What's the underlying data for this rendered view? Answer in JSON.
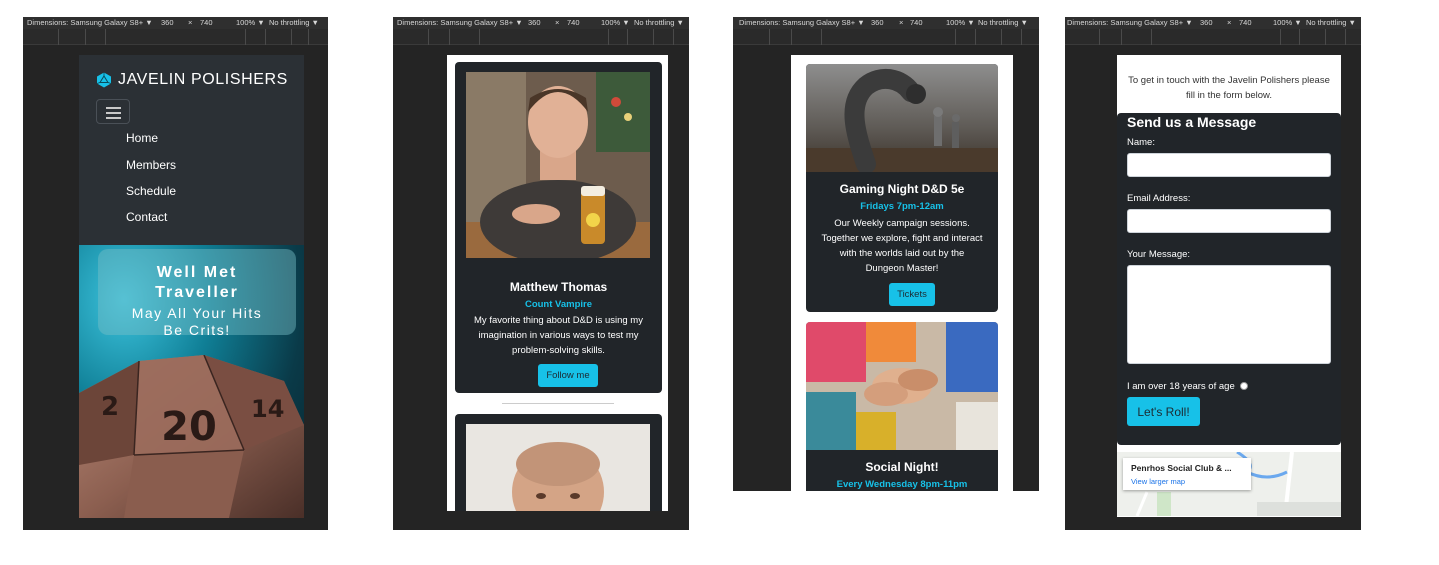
{
  "devtools": {
    "dimensions_label": "Dimensions: Samsung Galaxy S8+",
    "width": "360",
    "times": "×",
    "height": "740",
    "zoom": "100%",
    "throttling": "No throttling",
    "caret": "▼"
  },
  "site": {
    "brand": "JAVELIN POLISHERS",
    "nav": [
      "Home",
      "Members",
      "Schedule",
      "Contact"
    ],
    "hero_title_line1": "Well Met",
    "hero_title_line2": "Traveller",
    "hero_sub_line1": "May All Your Hits",
    "hero_sub_line2": "Be Crits!",
    "die_number": "20",
    "die_left": "2",
    "die_right": "14"
  },
  "members": {
    "name": "Matthew Thomas",
    "role": "Count Vampire",
    "bio": [
      "My favorite thing about D&D is using my",
      "imagination in various ways to test my",
      "problem-solving skills."
    ],
    "button": "Follow me"
  },
  "schedule": {
    "event1_title": "Gaming Night D&D 5e",
    "event1_time": "Fridays 7pm-12am",
    "event1_desc": [
      "Our Weekly campaign sessions.",
      "Together we explore, fight and interact",
      "with the worlds laid out by the",
      "Dungeon Master!"
    ],
    "event1_button": "Tickets",
    "event2_title": "Social Night!",
    "event2_time": "Every Wednesday 8pm-11pm"
  },
  "contact": {
    "intro_line1": "To get in touch with the Javelin Polishers please",
    "intro_line2": "fill in the form below.",
    "form_title": "Send us a Message",
    "name_label": "Name:",
    "email_label": "Email Address:",
    "message_label": "Your Message:",
    "age_label": "I am over 18 years of age",
    "submit": "Let's Roll!",
    "map_place": "Penrhos Social Club & ...",
    "map_link": "View larger map"
  },
  "colors": {
    "accent": "#17c1e8",
    "card_bg": "#212529",
    "nav_bg": "#2b3035",
    "devtools_bg": "#242424"
  }
}
